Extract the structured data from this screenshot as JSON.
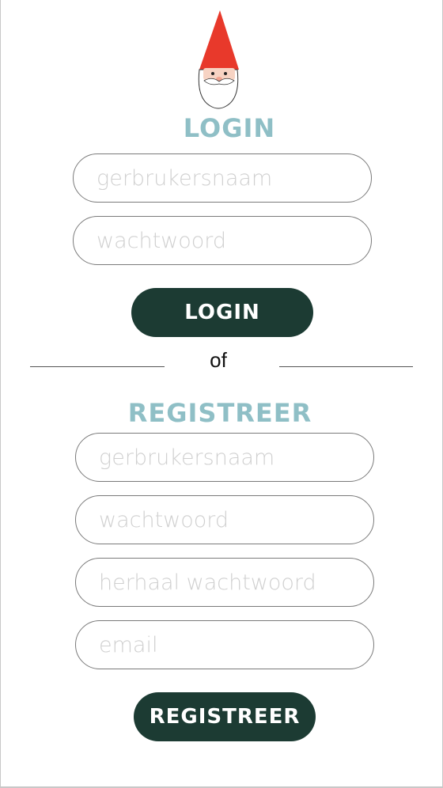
{
  "colors": {
    "heading": "#8fbfc6",
    "button_bg": "#1c3b33",
    "button_text": "#ffffff",
    "field_border": "#7a7a7a",
    "placeholder": "#d0d0d0"
  },
  "logo": {
    "icon": "gnome-icon"
  },
  "login": {
    "title": "LOGIN",
    "username_placeholder": "gerbrukersnaam",
    "password_placeholder": "wachtwoord",
    "button_label": "LOGIN"
  },
  "divider": {
    "text": "of"
  },
  "register": {
    "title": "REGISTREER",
    "username_placeholder": "gerbrukersnaam",
    "password_placeholder": "wachtwoord",
    "repeat_password_placeholder": "herhaal wachtwoord",
    "email_placeholder": "email",
    "button_label": "REGISTREER"
  }
}
